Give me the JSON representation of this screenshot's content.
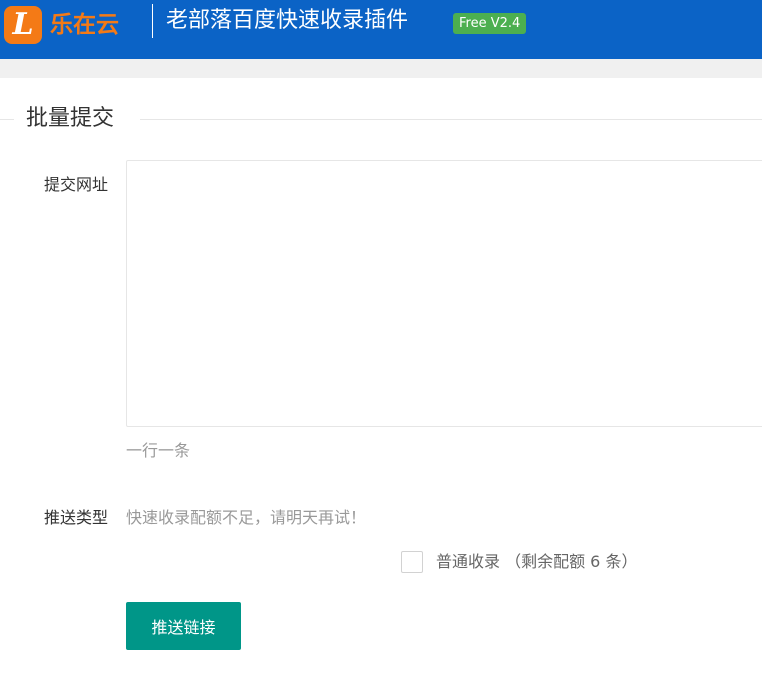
{
  "header": {
    "logo_letter": "L",
    "logo_text": "乐在云",
    "title": "老部落百度快速收录插件",
    "version_badge": "Free V2.4"
  },
  "colors": {
    "header_bg": "#0b63c6",
    "logo_orange": "#f47a16",
    "badge_green": "#4caf50",
    "button_teal": "#009688"
  },
  "icons": {
    "logo": "lezaiyun-logo-icon"
  },
  "section": {
    "title": "批量提交"
  },
  "form": {
    "url_label": "提交网址",
    "url_value": "",
    "url_hint": "一行一条",
    "type_label": "推送类型",
    "quota_warning": "快速收录配额不足，请明天再试！",
    "normal_option_label": "普通收录 （剩余配额 6 条）",
    "normal_option_checked": false,
    "submit_label": "推送链接"
  }
}
